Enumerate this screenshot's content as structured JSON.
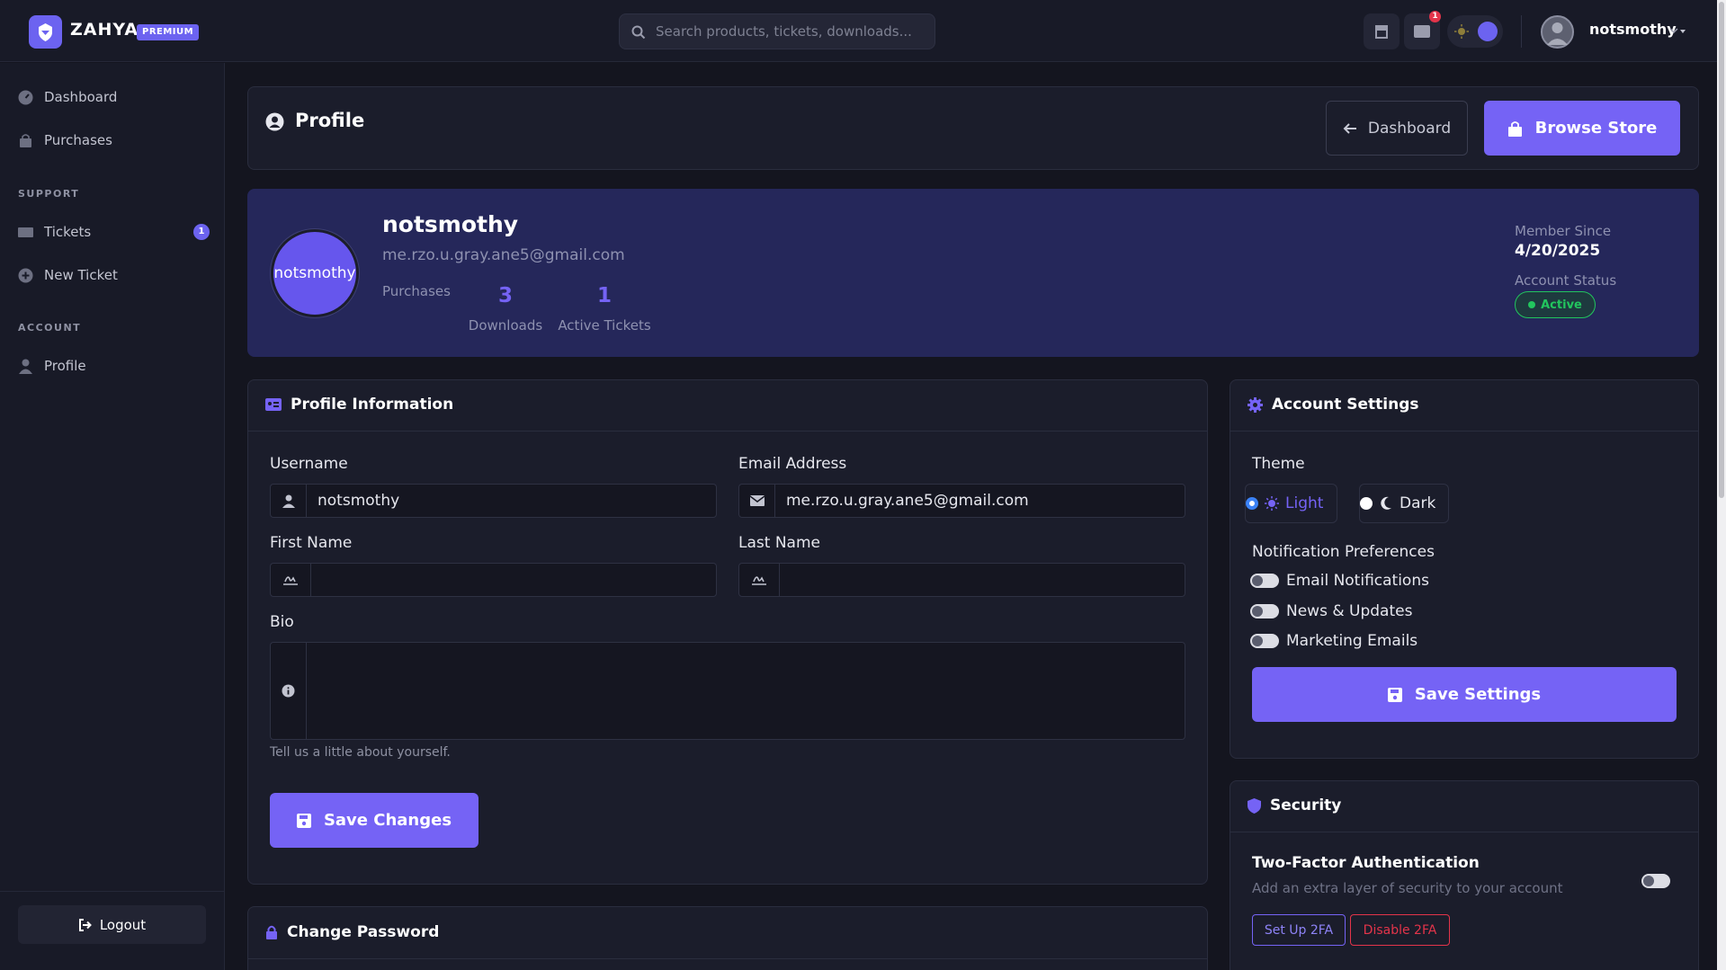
{
  "app": {
    "name": "ZAHYA",
    "badge": "PREMIUM"
  },
  "search": {
    "placeholder": "Search products, tickets, downloads..."
  },
  "topbar": {
    "notification_count": "1",
    "username": "notsmothy"
  },
  "sidebar": {
    "items": [
      {
        "label": "Dashboard"
      },
      {
        "label": "Purchases"
      }
    ],
    "support_label": "SUPPORT",
    "support_items": [
      {
        "label": "Tickets",
        "badge": "1"
      },
      {
        "label": "New Ticket"
      }
    ],
    "account_label": "ACCOUNT",
    "account_items": [
      {
        "label": "Profile"
      }
    ],
    "logout_label": "Logout"
  },
  "page": {
    "title": "Profile",
    "dashboard_button": "Dashboard",
    "browse_button": "Browse Store"
  },
  "profile": {
    "avatar_text": "notsmothy",
    "username": "notsmothy",
    "email": "me.rzo.u.gray.ane5@gmail.com",
    "purchases_label": "Purchases",
    "downloads_count": "3",
    "downloads_label": "Downloads",
    "tickets_count": "1",
    "tickets_label": "Active Tickets",
    "member_since_label": "Member Since",
    "member_since": "4/20/2025",
    "status_label": "Account Status",
    "status": "Active"
  },
  "profile_info": {
    "title": "Profile Information",
    "username_label": "Username",
    "username_value": "notsmothy",
    "email_label": "Email Address",
    "email_value": "me.rzo.u.gray.ane5@gmail.com",
    "first_name_label": "First Name",
    "first_name_value": "",
    "last_name_label": "Last Name",
    "last_name_value": "",
    "bio_label": "Bio",
    "bio_value": "",
    "bio_help": "Tell us a little about yourself.",
    "save_button": "Save Changes"
  },
  "account_settings": {
    "title": "Account Settings",
    "theme_label": "Theme",
    "theme_options": [
      {
        "label": "Light",
        "selected": true
      },
      {
        "label": "Dark",
        "selected": false
      }
    ],
    "notif_label": "Notification Preferences",
    "prefs": [
      {
        "label": "Email Notifications"
      },
      {
        "label": "News & Updates"
      },
      {
        "label": "Marketing Emails"
      }
    ],
    "save_button": "Save Settings"
  },
  "security": {
    "title": "Security",
    "twofa_title": "Two-Factor Authentication",
    "twofa_desc": "Add an extra layer of security to your account",
    "setup_button": "Set Up 2FA",
    "disable_button": "Disable 2FA"
  },
  "change_password": {
    "title": "Change Password"
  },
  "colors": {
    "accent": "#7563f5",
    "background": "#14151f",
    "card": "#1b1d2b",
    "hero": "#25275a",
    "success": "#22c55e",
    "danger": "#e3344a"
  }
}
